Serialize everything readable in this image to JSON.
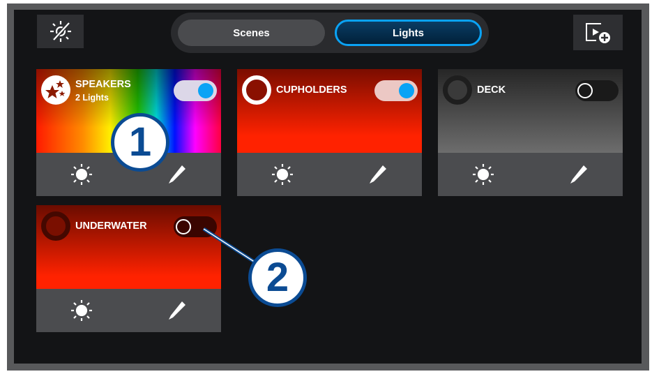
{
  "header": {
    "lights_off_icon": "sun-slash-icon",
    "tabs": [
      {
        "label": "Scenes",
        "active": false
      },
      {
        "label": "Lights",
        "active": true
      }
    ],
    "add_scene_icon": "play-plus-icon"
  },
  "cards": [
    {
      "title": "SPEAKERS",
      "subtitle": "2 Lights",
      "on": true,
      "icon": "stars-icon"
    },
    {
      "title": "CUPHOLDERS",
      "on": true,
      "icon": "ring-icon"
    },
    {
      "title": "DECK",
      "on": false,
      "icon": "ring-icon"
    },
    {
      "title": "UNDERWATER",
      "on": false,
      "icon": "ring-icon"
    }
  ],
  "callouts": [
    "1",
    "2"
  ],
  "colors": {
    "accent": "#0aa3f5",
    "callout": "#0b4b93",
    "red": "#ff2200"
  }
}
